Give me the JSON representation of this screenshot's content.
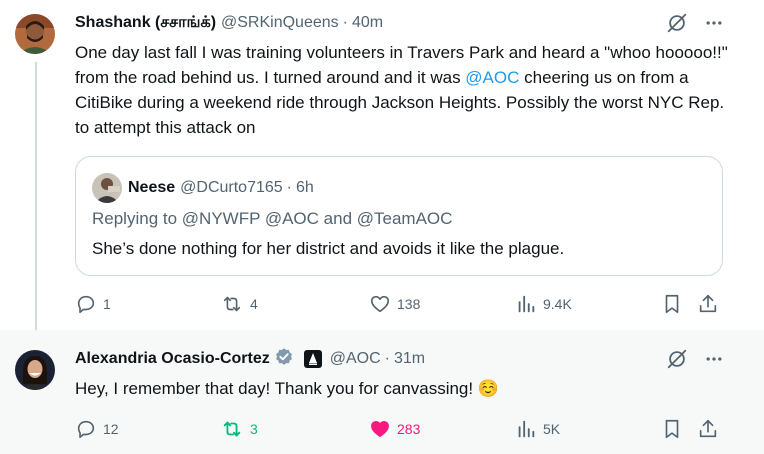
{
  "tweet1": {
    "name": "Shashank (சசாங்க்)",
    "handle": "@SRKinQueens",
    "separator": "·",
    "time": "40m",
    "text_part1": "One day last fall I was training volunteers in Travers Park and heard a \"whoo hooooo!!\" from the road behind us. I turned around and it was ",
    "text_mention": "@AOC",
    "text_part2": " cheering us on from a CitiBike during a weekend ride through Jackson Heights. Possibly the worst NYC Rep. to attempt this attack on",
    "quote": {
      "name": "Neese",
      "handle": "@DCurto7165",
      "separator": "·",
      "time": "6h",
      "replying_prefix": "Replying to ",
      "replying_mentions": "@NYWFP @AOC and @TeamAOC",
      "text": "She’s done nothing for her district and avoids it like the plague."
    },
    "actions": {
      "replies": "1",
      "reposts": "4",
      "likes": "138",
      "views": "9.4K"
    }
  },
  "tweet2": {
    "name": "Alexandria Ocasio-Cortez",
    "handle": "@AOC",
    "separator": "·",
    "time": "31m",
    "text": "Hey, I remember that day! Thank you for canvassing! ☺️",
    "actions": {
      "replies": "12",
      "reposts": "3",
      "likes": "283",
      "views": "5K"
    }
  },
  "colors": {
    "text": "#0f1419",
    "secondary": "#536471",
    "link": "#1d9bf0",
    "repost_active": "#00ba7c",
    "like_active": "#f91880",
    "border": "#cfd9de"
  },
  "icons": [
    "grok-icon",
    "more-icon",
    "reply-icon",
    "repost-icon",
    "like-icon",
    "views-icon",
    "bookmark-icon",
    "share-icon",
    "verified-icon",
    "affiliate-badge-icon"
  ]
}
